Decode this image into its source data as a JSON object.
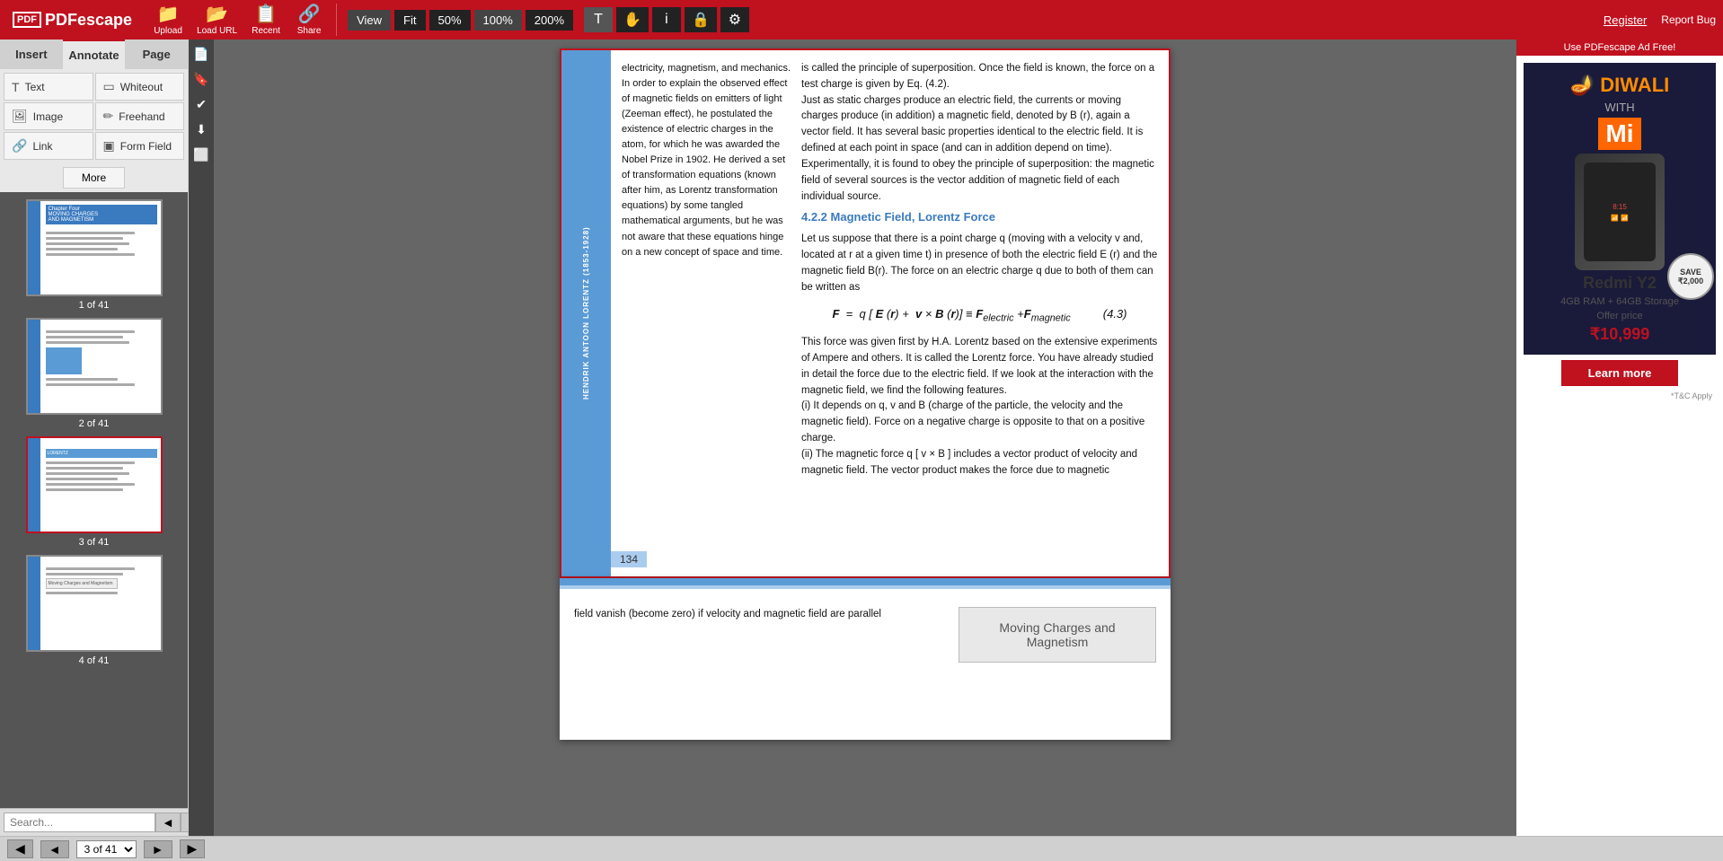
{
  "app": {
    "name": "PDFescape",
    "register": "Register",
    "report_bug": "Report Bug"
  },
  "toolbar": {
    "upload": "Upload",
    "load_url": "Load URL",
    "recent": "Recent",
    "share": "Share",
    "view": "View",
    "zoom_fit": "Fit",
    "zoom_50": "50%",
    "zoom_100": "100%",
    "zoom_200": "200%"
  },
  "tabs": {
    "insert": "Insert",
    "annotate": "Annotate",
    "page": "Page"
  },
  "annotate_tools": {
    "text": "Text",
    "whiteout": "Whiteout",
    "image": "Image",
    "freehand": "Freehand",
    "link": "Link",
    "form_field": "Form Field",
    "more": "More"
  },
  "thumbnails": [
    {
      "label": "1 of 41",
      "active": false
    },
    {
      "label": "2 of 41",
      "active": false
    },
    {
      "label": "3 of 41",
      "active": true
    },
    {
      "label": "4 of 41",
      "active": false
    }
  ],
  "search": {
    "placeholder": "Search..."
  },
  "page3": {
    "sidebar_text": "HENDRIK ANTOON LORENTZ (1853-1928)",
    "page_number": "134",
    "content_col1": "electricity, magnetism, and mechanics. In order to explain the observed effect of magnetic fields on emitters of light (Zeeman effect), he postulated the existence of electric charges in the atom, for which he was awarded the Nobel Prize in 1902. He derived a set of transformation equations (known after him, as Lorentz transformation equations) by some tangled mathematical arguments, but he was not aware that these equations hinge on a new concept of space and time.",
    "content_col2_p1": "is called the principle of superposition. Once the field is known, the force on a test charge is given by Eq. (4.2).",
    "content_col2_p2": "Just as static charges produce an electric field, the currents or moving charges produce (in addition) a magnetic field, denoted by B (r), again a vector field. It has several basic properties identical to the electric field. It is defined at each point in space (and can in addition depend on time). Experimentally, it is found to obey the principle of superposition: the magnetic field of several sources is the vector addition of magnetic field of each individual source.",
    "section_heading": "4.2.2  Magnetic Field,  Lorentz  Force",
    "section_p1": "Let us suppose that there is  a point charge q (moving with a velocity v and, located at r at a given time t) in presence of both the electric field E (r) and the magnetic field B(r).  The force on an electric charge q due to both of them can be written as",
    "formula": "F  =  q [ E (r) +  v × B (r)] ≡ F_electric + F_magnetic         (4.3)",
    "section_p2": "This force was given first  by H.A. Lorentz based on the extensive experiments of Ampere and others. It is called the Lorentz force. You have already studied in detail the force due to the electric field.  If we look at the interaction with the magnetic field, we find the following features.",
    "item_i": "(i)   It depends on q, v and B (charge of the particle, the velocity and the magnetic field). Force on a negative charge is opposite to that on a positive charge.",
    "item_ii": "(ii)  The magnetic force q [ v × B ] includes a vector product of velocity and magnetic field. The vector product makes the force due to magnetic"
  },
  "page4": {
    "chapter_banner": "Moving Charges and\nMagnetism",
    "bottom_text": "field vanish (become zero) if  velocity and magnetic field are parallel"
  },
  "ad": {
    "top_bar": "Use PDFescape Ad Free!",
    "diwali": "DIWALI\nWITH MI",
    "model": "Redmi Y2",
    "specs": "4GB RAM + 64GB Storage",
    "offer_label": "Offer price",
    "price": "₹10,999",
    "learn_more": "Learn more",
    "save_label": "SAVE\n₹2,000",
    "terms": "*T&C Apply"
  },
  "bottom_bar": {
    "nav_left": "◀",
    "nav_left2": "◄",
    "nav_right": "▶",
    "nav_right2": "►",
    "page_value": "3 of 41"
  }
}
